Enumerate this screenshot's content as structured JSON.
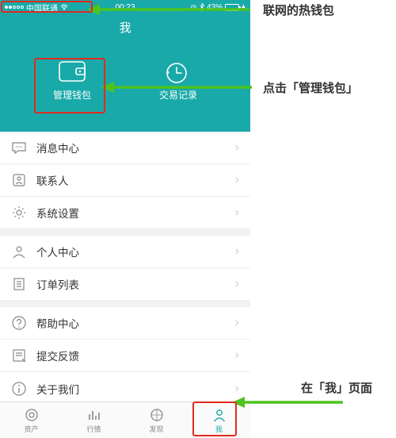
{
  "status": {
    "carrier": "中国联通",
    "time": "00:23",
    "battery_pct": "43%"
  },
  "header": {
    "title": "我",
    "actions": [
      {
        "label": "管理钱包"
      },
      {
        "label": "交易记录"
      }
    ]
  },
  "sections": [
    [
      {
        "label": "消息中心",
        "icon": "chat"
      },
      {
        "label": "联系人",
        "icon": "contact"
      },
      {
        "label": "系统设置",
        "icon": "gear"
      }
    ],
    [
      {
        "label": "个人中心",
        "icon": "person"
      },
      {
        "label": "订单列表",
        "icon": "list"
      }
    ],
    [
      {
        "label": "帮助中心",
        "icon": "help"
      },
      {
        "label": "提交反馈",
        "icon": "feedback"
      },
      {
        "label": "关于我们",
        "icon": "info"
      }
    ]
  ],
  "tabs": [
    {
      "label": "资产"
    },
    {
      "label": "行情"
    },
    {
      "label": "发现"
    },
    {
      "label": "我"
    }
  ],
  "annotations": {
    "a1": "联网的热钱包",
    "a2": "点击「管理钱包」",
    "a3": "在「我」页面"
  }
}
